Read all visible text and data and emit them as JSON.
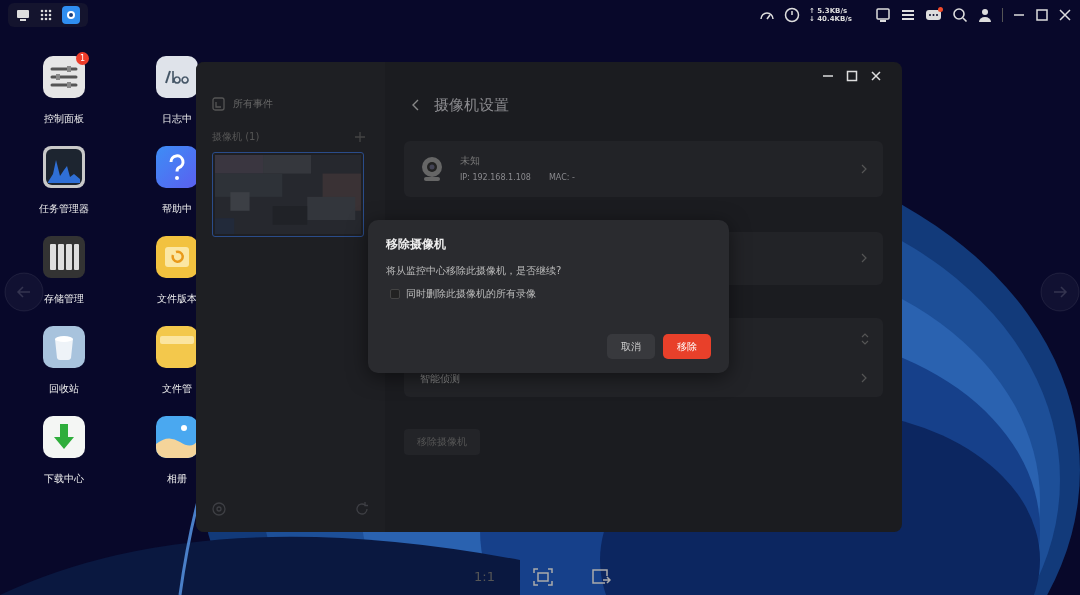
{
  "top_bar": {
    "upload": "↑ 5.3KB/s",
    "download": "↓ 40.4KB/s",
    "message_unread": true
  },
  "desktop_icons": [
    {
      "label": "控制面板",
      "kind": "sliders",
      "badge": "1"
    },
    {
      "label": "日志中",
      "kind": "logs"
    },
    {
      "label": "任务管理器",
      "kind": "monitor"
    },
    {
      "label": "帮助中",
      "kind": "help"
    },
    {
      "label": "存储管理",
      "kind": "storage"
    },
    {
      "label": "文件版本",
      "kind": "version"
    },
    {
      "label": "回收站",
      "kind": "trash"
    },
    {
      "label": "文件管",
      "kind": "folder"
    },
    {
      "label": "下载中心",
      "kind": "download"
    },
    {
      "label": "相册",
      "kind": "photos"
    }
  ],
  "window": {
    "sidebar": {
      "all_events": "所有事件",
      "camera_section": "摄像机 (1)",
      "cameras": [
        {
          "selected": true
        }
      ]
    },
    "title": "摄像机设置",
    "camera": {
      "name": "未知",
      "ip": "IP: 192.168.1.108",
      "mac": "MAC: -"
    },
    "rows": [
      {
        "label": "智能侦测"
      }
    ],
    "remove_button": "移除摄像机"
  },
  "dialog": {
    "title": "移除摄像机",
    "message": "将从监控中心移除此摄像机，是否继续?",
    "checkbox": {
      "label": "同时删除此摄像机的所有录像",
      "checked": false
    },
    "buttons": [
      {
        "label": "取消",
        "kind": "secondary"
      },
      {
        "label": "移除",
        "kind": "danger"
      }
    ]
  },
  "bottom_toolbar": {
    "zoom_label": "1:1"
  }
}
